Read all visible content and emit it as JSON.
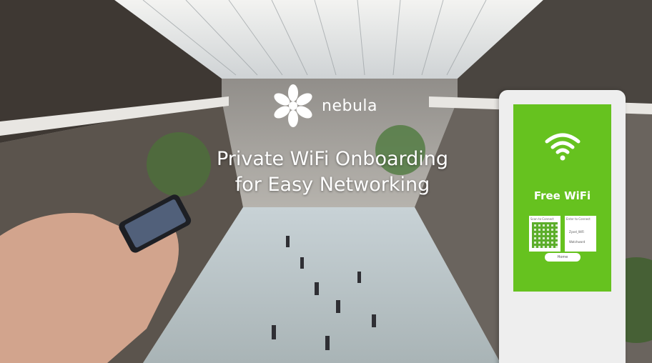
{
  "brand": {
    "name": "nebula"
  },
  "headline": {
    "line1": "Private WiFi Onboarding",
    "line2": "for Easy Networking"
  },
  "kiosk": {
    "title": "Free WiFi",
    "scan_label": "Scan to Connect",
    "enter_label": "Enter to Connect",
    "ssid_label": "Zyxel_WiFi",
    "password_label": "Watchword",
    "button_label": "Home"
  },
  "colors": {
    "kiosk_screen": "#66c21f",
    "text": "#ffffff"
  },
  "icons": [
    "nebula-logo-icon",
    "wifi-icon",
    "qr-code-icon",
    "smartphone-icon"
  ]
}
